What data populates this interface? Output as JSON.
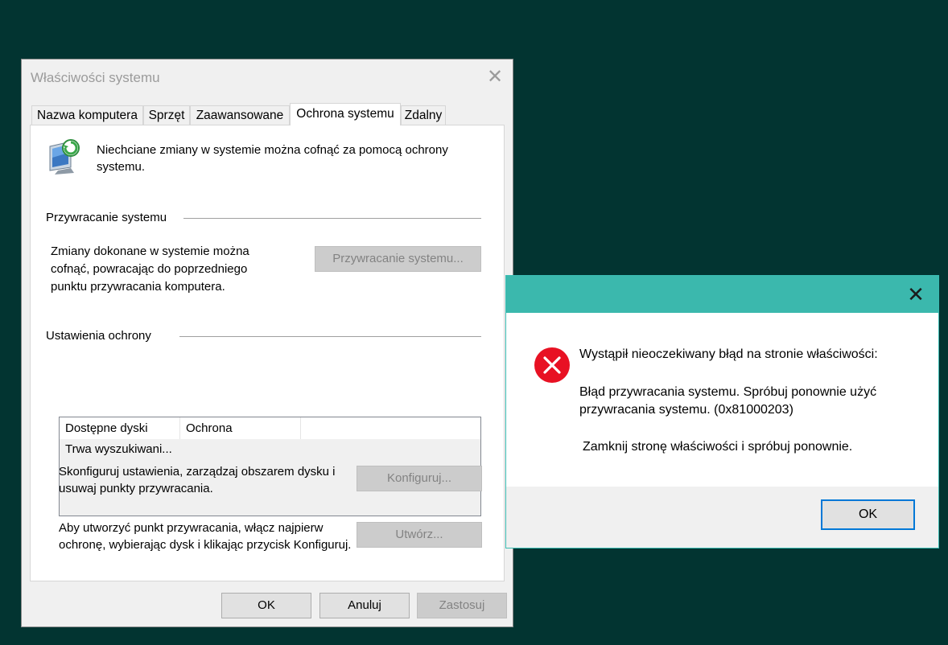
{
  "main_dialog": {
    "title": "Właściwości systemu",
    "close_glyph": "✕",
    "tabs": [
      {
        "label": "Nazwa komputera"
      },
      {
        "label": "Sprzęt"
      },
      {
        "label": "Zaawansowane"
      },
      {
        "label": "Ochrona systemu"
      },
      {
        "label": "Zdalny"
      }
    ],
    "active_tab": "Ochrona systemu",
    "intro_icon": "system-protection-icon",
    "intro_text": "Niechciane zmiany w systemie można cofnąć za pomocą ochrony systemu.",
    "restore_section": {
      "title": "Przywracanie systemu",
      "description": "Zmiany dokonane w systemie można cofnąć, powracając do poprzedniego punktu przywracania komputera.",
      "button": "Przywracanie systemu..."
    },
    "protection_section": {
      "title": "Ustawienia ochrony",
      "columns": [
        "Dostępne dyski",
        "Ochrona"
      ],
      "status": "Trwa wyszukiwani...",
      "configure_text": "Skonfiguruj ustawienia, zarządzaj obszarem dysku i usuwaj punkty przywracania.",
      "configure_button": "Konfiguruj...",
      "create_text": "Aby utworzyć punkt przywracania, włącz najpierw ochronę, wybierając dysk i klikając przycisk Konfiguruj.",
      "create_button": "Utwórz..."
    },
    "footer": {
      "ok": "OK",
      "cancel": "Anuluj",
      "apply": "Zastosuj"
    }
  },
  "error_dialog": {
    "close_glyph": "✕",
    "icon": "error-icon",
    "heading": "Wystąpił nieoczekiwany błąd na stronie właściwości:",
    "message_line1": "Błąd przywracania systemu. Spróbuj ponownie użyć",
    "message_line2": "przywracania systemu. (0x81000203)",
    "instruction": "Zamknij stronę właściwości i spróbuj ponownie.",
    "ok": "OK"
  },
  "colors": {
    "desktop": "#023431",
    "error_titlebar": "#3bb8ad",
    "error_icon": "#e81123",
    "focus_border": "#0078d7"
  }
}
